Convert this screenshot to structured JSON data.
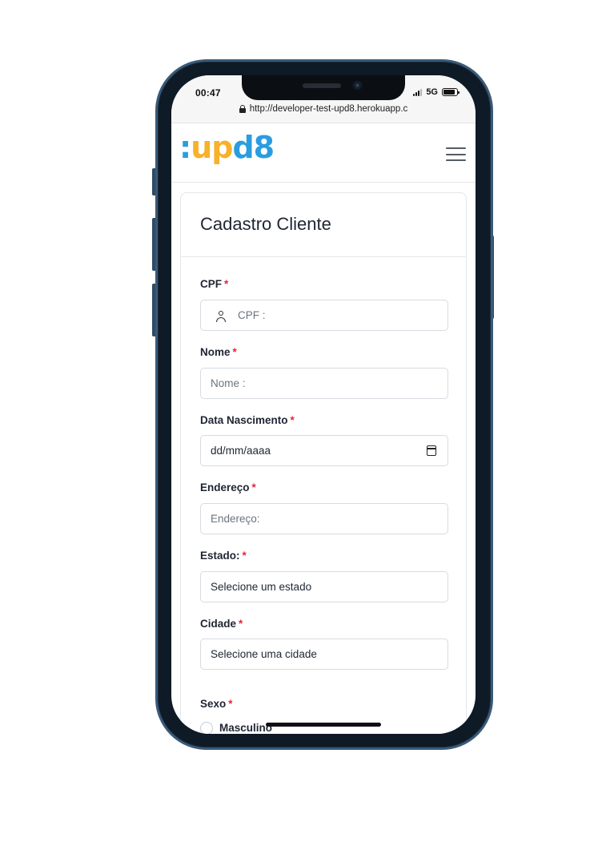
{
  "status": {
    "time": "00:47",
    "network": "5G"
  },
  "browser": {
    "url": "http://developer-test-upd8.herokuapp.c"
  },
  "header": {
    "logo_parts": [
      ":",
      "up",
      "d8"
    ],
    "menu_icon": "hamburger-menu-icon"
  },
  "form": {
    "title": "Cadastro Cliente",
    "required_marker": "*",
    "cpf": {
      "label": "CPF",
      "placeholder": "CPF :",
      "icon": "user-icon"
    },
    "nome": {
      "label": "Nome",
      "placeholder": "Nome :"
    },
    "data_nascimento": {
      "label": "Data Nascimento",
      "value": "dd/mm/aaaa",
      "icon": "calendar-icon"
    },
    "endereco": {
      "label": "Endereço",
      "placeholder": "Endereço:"
    },
    "estado": {
      "label": "Estado:",
      "selected": "Selecione um estado"
    },
    "cidade": {
      "label": "Cidade",
      "selected": "Selecione uma cidade"
    },
    "sexo": {
      "label": "Sexo",
      "options": [
        "Masculino"
      ]
    }
  },
  "colors": {
    "logo_blue": "#2a9de0",
    "logo_yellow": "#f7b12a",
    "required_red": "#e3253c"
  }
}
